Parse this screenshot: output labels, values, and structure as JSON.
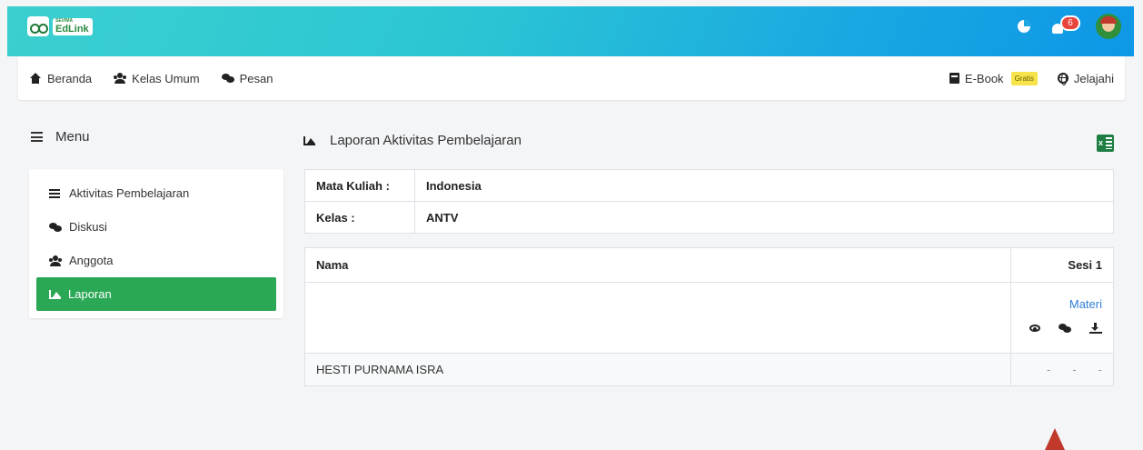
{
  "brand": {
    "logo_text": "EdLink",
    "logo_small": "SEVIMA"
  },
  "header": {
    "notification_count": "6"
  },
  "nav": {
    "left": [
      "Beranda",
      "Kelas Umum",
      "Pesan"
    ],
    "ebook": "E-Book",
    "ebook_badge": "Gratis",
    "explore": "Jelajahi"
  },
  "sidebar": {
    "title": "Menu",
    "items": [
      "Aktivitas Pembelajaran",
      "Diskusi",
      "Anggota",
      "Laporan"
    ],
    "active": "Laporan"
  },
  "content": {
    "title": "Laporan Aktivitas Pembelajaran",
    "info": [
      {
        "label": "Mata Kuliah :",
        "value": "Indonesia"
      },
      {
        "label": "Kelas :",
        "value": "ANTV"
      }
    ],
    "table": {
      "col_name": "Nama",
      "col_session": "Sesi 1",
      "sub_header": "Materi",
      "rows": [
        {
          "name": "HESTI PURNAMA ISRA",
          "values": [
            "-",
            "-",
            "-"
          ]
        }
      ]
    }
  },
  "colors": {
    "accent_green": "#2aa855",
    "link_blue": "#2e7dd7",
    "badge_red": "#e8453c"
  }
}
